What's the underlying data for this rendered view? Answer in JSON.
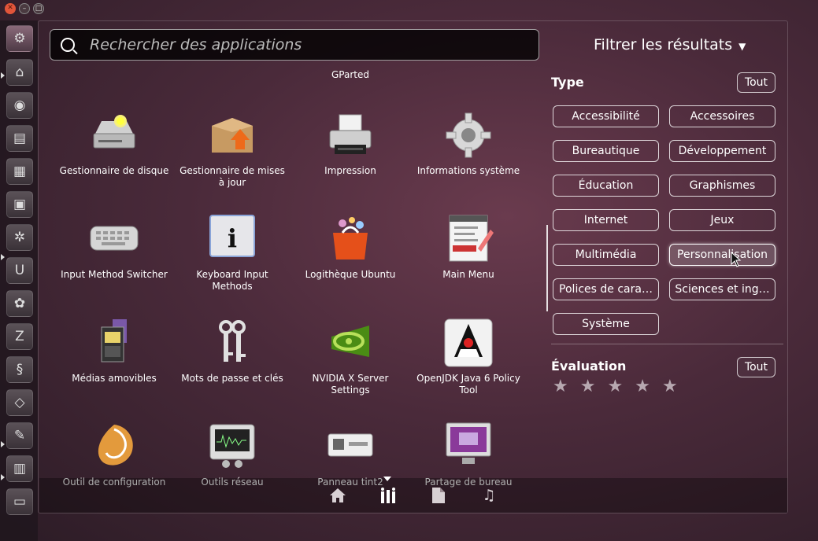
{
  "search": {
    "placeholder": "Rechercher des applications",
    "value": ""
  },
  "filter": {
    "title": "Filtrer les résultats",
    "type_heading": "Type",
    "type_all": "Tout",
    "types": [
      {
        "label": "Accessibilité",
        "active": false
      },
      {
        "label": "Accessoires",
        "active": false
      },
      {
        "label": "Bureautique",
        "active": false
      },
      {
        "label": "Développement",
        "active": false
      },
      {
        "label": "Éducation",
        "active": false
      },
      {
        "label": "Graphismes",
        "active": false
      },
      {
        "label": "Internet",
        "active": false
      },
      {
        "label": "Jeux",
        "active": false
      },
      {
        "label": "Multimédia",
        "active": false
      },
      {
        "label": "Personnalisation",
        "active": true
      },
      {
        "label": "Polices de cara…",
        "active": false
      },
      {
        "label": "Sciences et ing…",
        "active": false
      },
      {
        "label": "Système",
        "active": false
      }
    ],
    "rating_heading": "Évaluation",
    "rating_all": "Tout",
    "rating_stars": 5
  },
  "top_label": "GParted",
  "apps": [
    {
      "label": "Gestionnaire de disque",
      "icon": "disk-icon"
    },
    {
      "label": "Gestionnaire de mises à jour",
      "icon": "update-box-icon"
    },
    {
      "label": "Impression",
      "icon": "printer-icon"
    },
    {
      "label": "Informations système",
      "icon": "gear-icon"
    },
    {
      "label": "Input Method Switcher",
      "icon": "keyboard-icon"
    },
    {
      "label": "Keyboard Input Methods",
      "icon": "info-icon"
    },
    {
      "label": "Logithèque Ubuntu",
      "icon": "shopping-bag-icon"
    },
    {
      "label": "Main Menu",
      "icon": "menu-editor-icon"
    },
    {
      "label": "Médias amovibles",
      "icon": "removable-media-icon"
    },
    {
      "label": "Mots de passe et clés",
      "icon": "keys-icon"
    },
    {
      "label": "NVIDIA X Server Settings",
      "icon": "nvidia-icon"
    },
    {
      "label": "OpenJDK Java 6 Policy Tool",
      "icon": "java-duke-icon"
    },
    {
      "label": "Outil de configuration",
      "icon": "shell-icon"
    },
    {
      "label": "Outils réseau",
      "icon": "network-monitor-icon"
    },
    {
      "label": "Panneau tint2",
      "icon": "panel-icon"
    },
    {
      "label": "Partage de bureau",
      "icon": "desktop-sharing-icon"
    }
  ],
  "lenses": [
    "home-icon",
    "applications-icon",
    "files-icon",
    "music-icon"
  ],
  "launcher": [
    "ubuntu-icon",
    "home-folder-icon",
    "firefox-icon",
    "writer-icon",
    "calc-icon",
    "impress-icon",
    "settings-icon",
    "ubuntu-one-icon",
    "configuration-icon",
    "filezilla-icon",
    "terminal-icon",
    "virtualbox-icon",
    "editor-icon",
    "storage-icon",
    "screen-icon"
  ],
  "colors": {
    "accent": "#e95420",
    "background": "#4a2a3a",
    "star": "#b7a8b0"
  }
}
